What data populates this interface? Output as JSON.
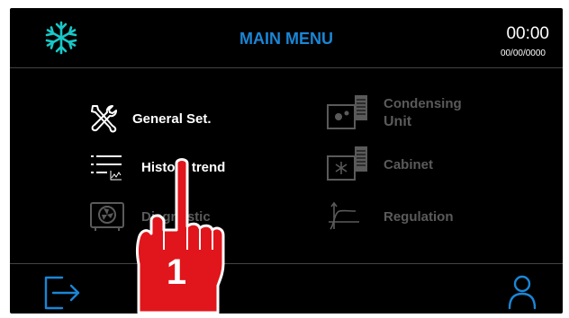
{
  "header": {
    "title": "MAIN MENU",
    "time": "00:00",
    "date": "00/00/0000",
    "logo_icon": "snowflake-logo-icon"
  },
  "menu": {
    "general_settings": {
      "label": "General Set.",
      "icon": "wrench-screwdriver-icon",
      "enabled": true
    },
    "history_trend": {
      "label": "History trend",
      "icon": "list-chart-icon",
      "enabled": true
    },
    "diagnostic": {
      "label": "Diagnostic",
      "icon": "unit-fan-icon",
      "enabled": false
    },
    "condensing_unit": {
      "label_line1": "Condensing",
      "label_line2": "Unit",
      "icon": "condensing-unit-icon",
      "enabled": false
    },
    "cabinet": {
      "label": "Cabinet",
      "icon": "cabinet-icon",
      "enabled": false
    },
    "regulation": {
      "label": "Regulation",
      "icon": "regulation-curve-icon",
      "enabled": false
    }
  },
  "footer": {
    "logout_icon": "logout-icon",
    "user_icon": "user-icon"
  },
  "overlay": {
    "step_number": "1",
    "pointer_icon": "pointing-hand-icon"
  },
  "colors": {
    "accent": "#1a86d6",
    "background": "#000000",
    "enabled_text": "#ffffff",
    "disabled_text": "#5a5a5a",
    "hand": "#e0161c"
  }
}
